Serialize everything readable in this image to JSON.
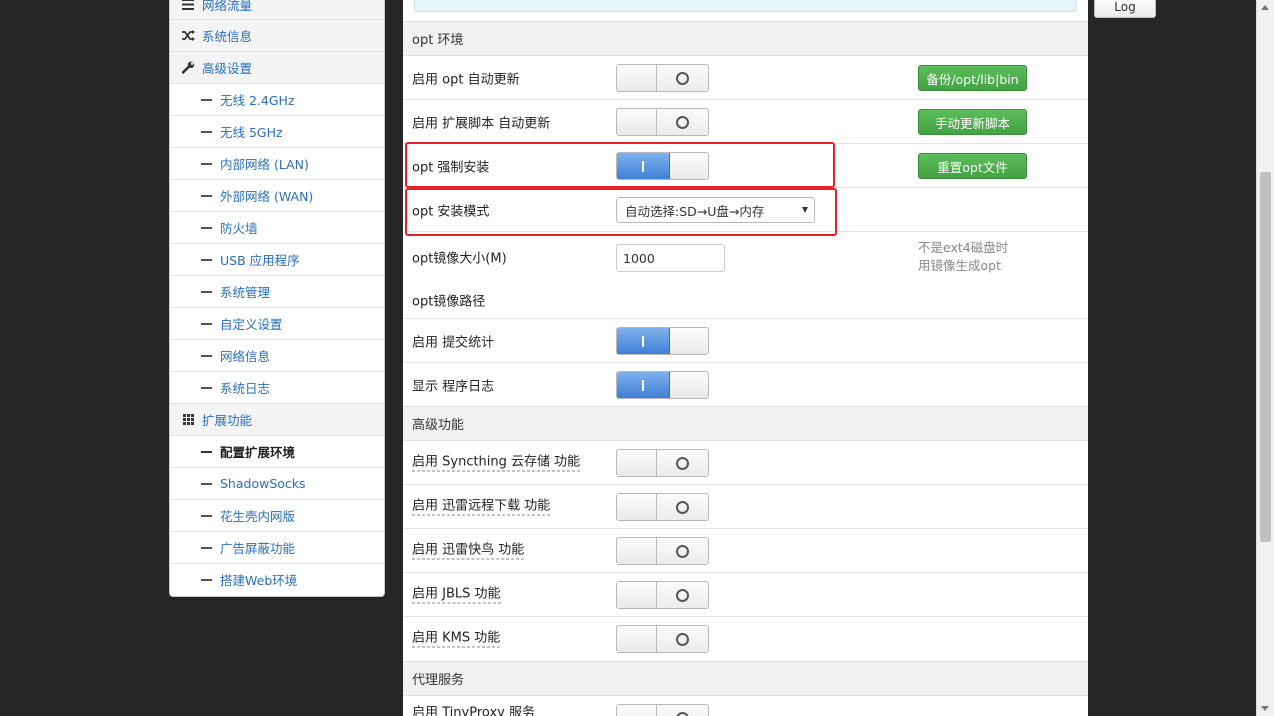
{
  "sidebar": {
    "top_items": [
      {
        "label": "网络流量",
        "icon": "list-icon"
      },
      {
        "label": "系统信息",
        "icon": "shuffle-icon"
      },
      {
        "label": "高级设置",
        "icon": "wrench-icon"
      }
    ],
    "sub_items_1": [
      {
        "label": "无线 2.4GHz"
      },
      {
        "label": "无线 5GHz"
      },
      {
        "label": "内部网络 (LAN)"
      },
      {
        "label": "外部网络 (WAN)"
      },
      {
        "label": "防火墙"
      },
      {
        "label": "USB 应用程序"
      },
      {
        "label": "系统管理"
      },
      {
        "label": "自定义设置"
      },
      {
        "label": "网络信息"
      },
      {
        "label": "系统日志"
      }
    ],
    "extension": {
      "label": "扩展功能",
      "icon": "grid-icon"
    },
    "sub_items_2": [
      {
        "label": "配置扩展环境",
        "active": true
      },
      {
        "label": "ShadowSocks"
      },
      {
        "label": "花生壳内网版"
      },
      {
        "label": "广告屏蔽功能"
      },
      {
        "label": "搭建Web环境"
      }
    ]
  },
  "main": {
    "sections": {
      "opt_env": "opt 环境",
      "advanced": "高级功能",
      "proxy": "代理服务"
    },
    "opt_rows": {
      "auto_update": {
        "label": "启用 opt 自动更新",
        "state": "off"
      },
      "ext_script_update": {
        "label": "启用 扩展脚本 自动更新",
        "state": "off"
      },
      "force_install": {
        "label": "opt 强制安装",
        "state": "on"
      },
      "install_mode": {
        "label": "opt 安装模式",
        "value": "自动选择:SD→U盘→内存"
      },
      "image_size": {
        "label": "opt镜像大小(M)",
        "value": "1000"
      },
      "image_path": {
        "label": "opt镜像路径"
      },
      "submit_stats": {
        "label": "启用 提交统计",
        "state": "on"
      },
      "show_log": {
        "label": "显示 程序日志",
        "state": "on"
      }
    },
    "buttons": {
      "backup": "备份/opt/lib|bin",
      "manual_update": "手动更新脚本",
      "reset_opt": "重置opt文件"
    },
    "hint": {
      "line1": "不是ext4磁盘时",
      "line2": "用镜像生成opt"
    },
    "advanced_rows": [
      {
        "label": "启用 Syncthing 云存储 功能",
        "state": "off"
      },
      {
        "label": "启用 迅雷远程下载 功能",
        "state": "off"
      },
      {
        "label": "启用 迅雷快鸟 功能",
        "state": "off"
      },
      {
        "label": "启用 JBLS 功能",
        "state": "off"
      },
      {
        "label": "启用 KMS 功能",
        "state": "off"
      }
    ],
    "proxy_rows": [
      {
        "label": "启用 TinyProxy 服务",
        "state": "off"
      }
    ]
  },
  "log_button": "Log",
  "colors": {
    "accent_blue": "#3f7fd6",
    "green_button": "#43a343",
    "highlight_red": "#e8202a",
    "link_blue": "#2a6ebb"
  }
}
